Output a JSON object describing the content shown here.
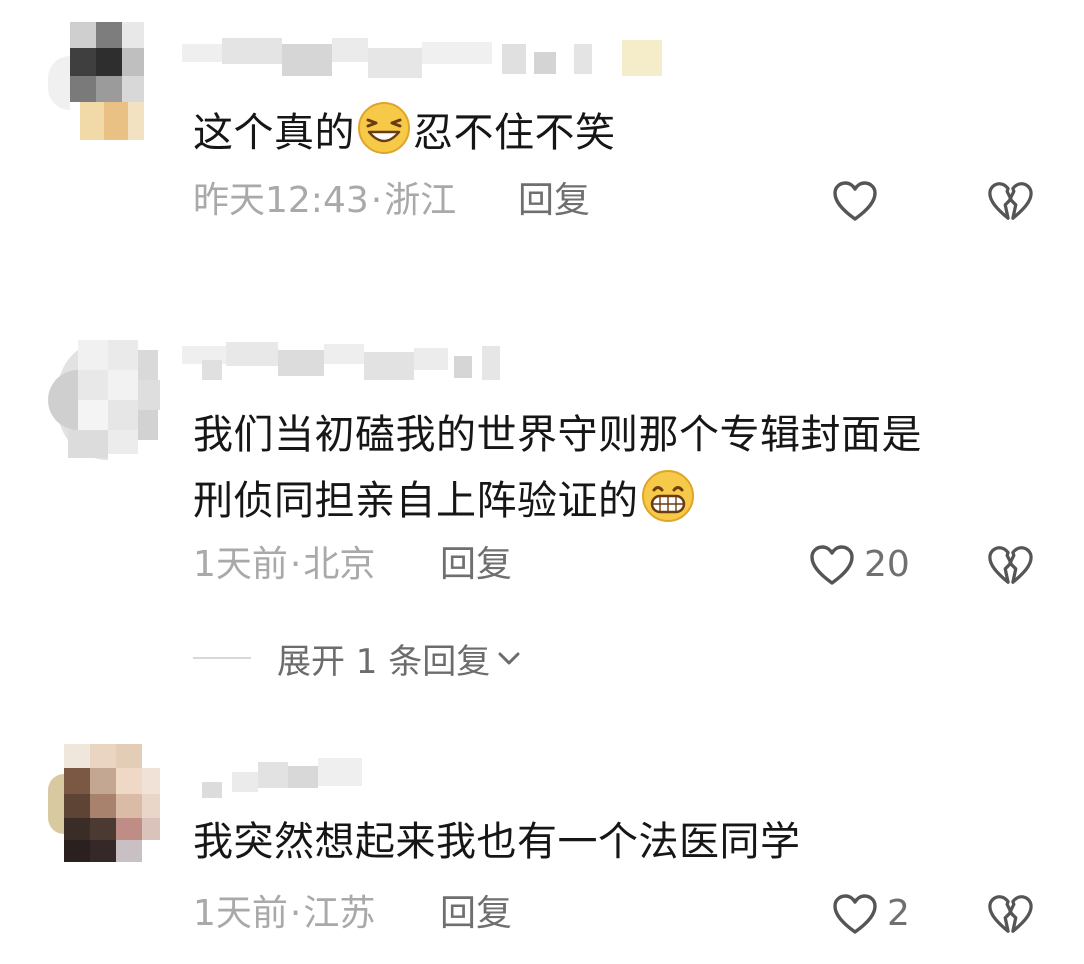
{
  "comments": [
    {
      "text_before_emoji": "这个真的",
      "emoji": "grinning-squint-emoji",
      "text_after_emoji": "忍不住不笑",
      "time": "昨天12:43",
      "separator": "·",
      "location": "浙江",
      "reply_label": "回复",
      "like_count": ""
    },
    {
      "line1": "我们当初磕我的世界守则那个专辑封面是",
      "line2_before_emoji": "刑侦同担亲自上阵验证的",
      "emoji": "grin-teeth-emoji",
      "time": "1天前",
      "separator": "·",
      "location": "北京",
      "reply_label": "回复",
      "like_count": "20",
      "expand_label": "展开 1 条回复"
    },
    {
      "text": "我突然想起来我也有一个法医同学",
      "time": "1天前",
      "separator": "·",
      "location": "江苏",
      "reply_label": "回复",
      "like_count": "2"
    }
  ],
  "icons": {
    "like": "heart-outline-icon",
    "dislike": "broken-heart-icon",
    "expand": "chevron-down-icon"
  },
  "colors": {
    "text": "#161616",
    "meta": "#a9a9a9",
    "reply": "#6f6f6f",
    "icon": "#555555",
    "emoji_face": "#f7c948"
  }
}
